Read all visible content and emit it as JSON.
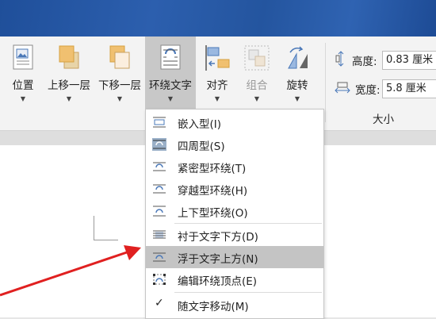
{
  "ribbon": {
    "buttons": [
      {
        "label": "位置"
      },
      {
        "label": "上移一层"
      },
      {
        "label": "下移一层"
      },
      {
        "label": "环绕文字"
      },
      {
        "label": "对齐"
      },
      {
        "label": "组合"
      },
      {
        "label": "旋转"
      }
    ],
    "size": {
      "height_label": "高度:",
      "height_value": "0.83 厘米",
      "width_label": "宽度:",
      "width_value": "5.8 厘米",
      "group_label": "大小"
    }
  },
  "menu": {
    "items": [
      {
        "label": "嵌入型(I)",
        "icon": "inline-wrap-icon"
      },
      {
        "label": "四周型(S)",
        "icon": "square-wrap-icon"
      },
      {
        "label": "紧密型环绕(T)",
        "icon": "tight-wrap-icon"
      },
      {
        "label": "穿越型环绕(H)",
        "icon": "through-wrap-icon"
      },
      {
        "label": "上下型环绕(O)",
        "icon": "top-bottom-wrap-icon"
      },
      {
        "label": "衬于文字下方(D)",
        "icon": "behind-text-icon"
      },
      {
        "label": "浮于文字上方(N)",
        "icon": "in-front-of-text-icon"
      },
      {
        "label": "编辑环绕顶点(E)",
        "icon": "edit-wrap-points-icon"
      },
      {
        "label": "随文字移动(M)",
        "icon": "check-icon"
      }
    ],
    "highlighted_item": "浮于文字上方(N)"
  },
  "colors": {
    "accent": "#2c5fae",
    "arrow": "#e02020",
    "icon_blue": "#4a78b8",
    "icon_orange": "#f0c070"
  }
}
